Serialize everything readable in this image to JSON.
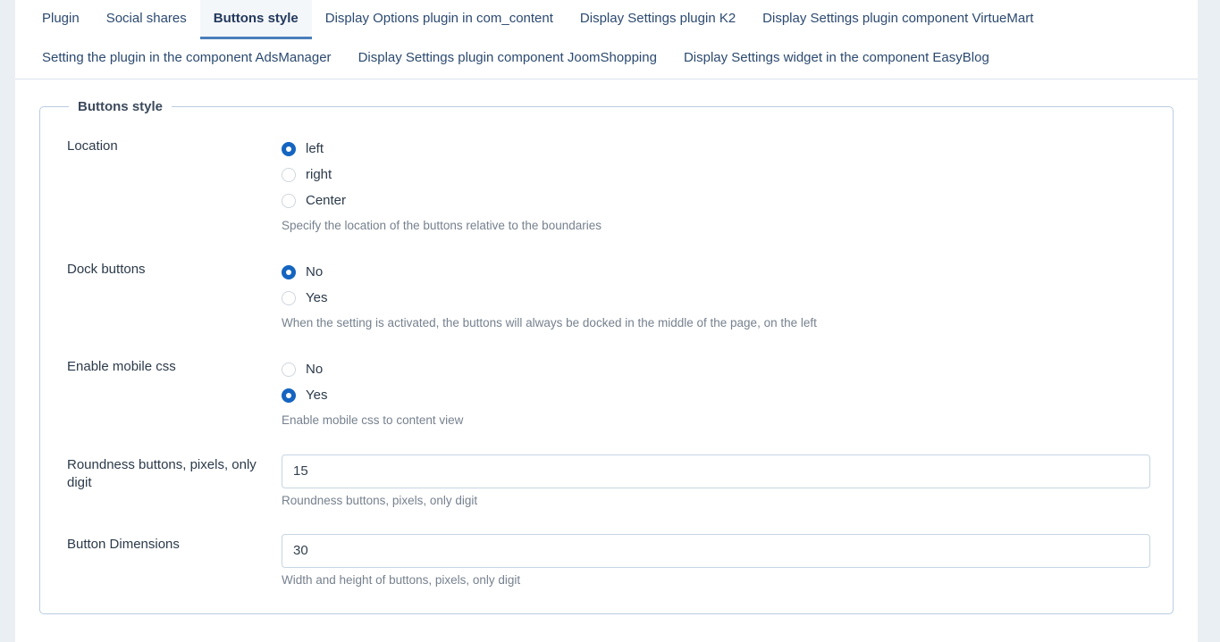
{
  "tabs": {
    "row1": [
      {
        "label": "Plugin",
        "active": false
      },
      {
        "label": "Social shares",
        "active": false
      },
      {
        "label": "Buttons style",
        "active": true
      },
      {
        "label": "Display Options plugin in com_content",
        "active": false
      },
      {
        "label": "Display Settings plugin K2",
        "active": false
      },
      {
        "label": "Display Settings plugin component VirtueMart",
        "active": false
      }
    ],
    "row2": [
      {
        "label": "Setting the plugin in the component AdsManager",
        "active": false
      },
      {
        "label": "Display Settings plugin component JoomShopping",
        "active": false
      },
      {
        "label": "Display Settings widget in the component EasyBlog",
        "active": false
      }
    ]
  },
  "fieldset": {
    "legend": "Buttons style"
  },
  "fields": {
    "location": {
      "label": "Location",
      "help": "Specify the location of the buttons relative to the boundaries",
      "options": [
        {
          "label": "left",
          "checked": true
        },
        {
          "label": "right",
          "checked": false
        },
        {
          "label": "Center",
          "checked": false
        }
      ]
    },
    "dock_buttons": {
      "label": "Dock buttons",
      "help": "When the setting is activated, the buttons will always be docked in the middle of the page, on the left",
      "options": [
        {
          "label": "No",
          "checked": true
        },
        {
          "label": "Yes",
          "checked": false
        }
      ]
    },
    "enable_mobile_css": {
      "label": "Enable mobile css",
      "help": "Enable mobile css to content view",
      "options": [
        {
          "label": "No",
          "checked": false
        },
        {
          "label": "Yes",
          "checked": true
        }
      ]
    },
    "roundness": {
      "label": "Roundness buttons, pixels, only digit",
      "help": "Roundness buttons, pixels, only digit",
      "value": "15",
      "placeholder": ""
    },
    "button_dimensions": {
      "label": "Button Dimensions",
      "help": "Width and height of buttons, pixels, only digit",
      "value": "30",
      "placeholder": ""
    }
  },
  "colors": {
    "page_bg": "#eaeff4",
    "card_bg": "#ffffff",
    "accent": "#1565c0",
    "active_tab_underline": "#4a7fba",
    "active_tab_bg": "#f4f7fa",
    "border": "#b9cde2",
    "help_text": "#76818e",
    "label_text": "#2b3a4a"
  }
}
